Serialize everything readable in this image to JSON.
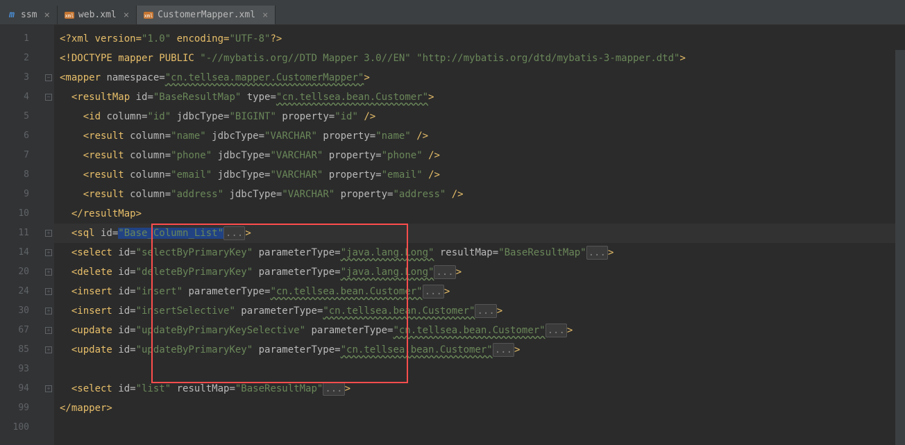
{
  "tabs": [
    {
      "label": "ssm",
      "icon": "m",
      "active": false,
      "icon_color": "#4a90d9"
    },
    {
      "label": "web.xml",
      "icon": "xml",
      "active": false,
      "icon_color": "#c57633"
    },
    {
      "label": "CustomerMapper.xml",
      "icon": "xml",
      "active": true,
      "icon_color": "#c57633"
    }
  ],
  "line_numbers": [
    "1",
    "2",
    "3",
    "4",
    "5",
    "6",
    "7",
    "8",
    "9",
    "10",
    "11",
    "14",
    "20",
    "24",
    "30",
    "67",
    "85",
    "93",
    "94",
    "99",
    "100"
  ],
  "fold_marks": [
    "",
    "",
    "−",
    "−",
    "",
    "",
    "",
    "",
    "",
    "",
    "+",
    "+",
    "+",
    "+",
    "+",
    "+",
    "+",
    "",
    "+",
    "",
    ""
  ],
  "code": {
    "l1": {
      "pre": "<?xml version=",
      "v1": "\"1.0\"",
      "mid": " encoding=",
      "v2": "\"UTF-8\"",
      "post": "?>"
    },
    "l2": {
      "pre": "<!DOCTYPE mapper PUBLIC ",
      "v1": "\"-//mybatis.org//DTD Mapper 3.0//EN\"",
      "sp": " ",
      "v2": "\"http://mybatis.org/dtd/mybatis-3-mapper.dtd\"",
      "post": ">"
    },
    "l3": {
      "open": "<mapper",
      "a1": " namespace=",
      "v1": "\"cn.tellsea.mapper.CustomerMapper\"",
      "close": ">"
    },
    "l4": {
      "open": "  <resultMap",
      "a1": " id=",
      "v1": "\"BaseResultMap\"",
      "a2": " type=",
      "v2": "\"cn.tellsea.bean.Customer\"",
      "close": ">"
    },
    "l5": {
      "open": "    <id",
      "a1": " column=",
      "v1": "\"id\"",
      "a2": " jdbcType=",
      "v2": "\"BIGINT\"",
      "a3": " property=",
      "v3": "\"id\"",
      "close": " />"
    },
    "l6": {
      "open": "    <result",
      "a1": " column=",
      "v1": "\"name\"",
      "a2": " jdbcType=",
      "v2": "\"VARCHAR\"",
      "a3": " property=",
      "v3": "\"name\"",
      "close": " />"
    },
    "l7": {
      "open": "    <result",
      "a1": " column=",
      "v1": "\"phone\"",
      "a2": " jdbcType=",
      "v2": "\"VARCHAR\"",
      "a3": " property=",
      "v3": "\"phone\"",
      "close": " />"
    },
    "l8": {
      "open": "    <result",
      "a1": " column=",
      "v1": "\"email\"",
      "a2": " jdbcType=",
      "v2": "\"VARCHAR\"",
      "a3": " property=",
      "v3": "\"email\"",
      "close": " />"
    },
    "l9": {
      "open": "    <result",
      "a1": " column=",
      "v1": "\"address\"",
      "a2": " jdbcType=",
      "v2": "\"VARCHAR\"",
      "a3": " property=",
      "v3": "\"address\"",
      "close": " />"
    },
    "l10": {
      "text": "  </resultMap>"
    },
    "l11": {
      "open": "  <sql",
      "a1": " id=",
      "v1": "\"Base_Column_List\"",
      "fold": "...",
      "close": ">"
    },
    "l14": {
      "open": "  <select",
      "a1": " id=",
      "v1": "\"selectByPrimaryKey\"",
      "a2": " parameterType=",
      "v2": "\"java.lang.Long\"",
      "a3": " resultMap=",
      "v3": "\"BaseResultMap\"",
      "fold": "...",
      "close": ">"
    },
    "l20": {
      "open": "  <delete",
      "a1": " id=",
      "v1": "\"deleteByPrimaryKey\"",
      "a2": " parameterType=",
      "v2": "\"java.lang.Long\"",
      "fold": "...",
      "close": ">"
    },
    "l24": {
      "open": "  <insert",
      "a1": " id=",
      "v1": "\"insert\"",
      "a2": " parameterType=",
      "v2": "\"cn.tellsea.bean.Customer\"",
      "fold": "...",
      "close": ">"
    },
    "l30": {
      "open": "  <insert",
      "a1": " id=",
      "v1": "\"insertSelective\"",
      "a2": " parameterType=",
      "v2": "\"cn.tellsea.bean.Customer\"",
      "fold": "...",
      "close": ">"
    },
    "l67": {
      "open": "  <update",
      "a1": " id=",
      "v1": "\"updateByPrimaryKeySelective\"",
      "a2": " parameterType=",
      "v2": "\"cn.tellsea.bean.Customer\"",
      "fold": "...",
      "close": ">"
    },
    "l85": {
      "open": "  <update",
      "a1": " id=",
      "v1": "\"updateByPrimaryKey\"",
      "a2": " parameterType=",
      "v2": "\"cn.tellsea.bean.Customer\"",
      "fold": "...",
      "close": ">"
    },
    "l93": {
      "text": ""
    },
    "l94": {
      "open": "  <select",
      "a1": " id=",
      "v1": "\"list\"",
      "a2": " resultMap=",
      "v2": "\"BaseResultMap\"",
      "fold": "...",
      "close": ">"
    },
    "l99": {
      "text": "</mapper>"
    }
  }
}
